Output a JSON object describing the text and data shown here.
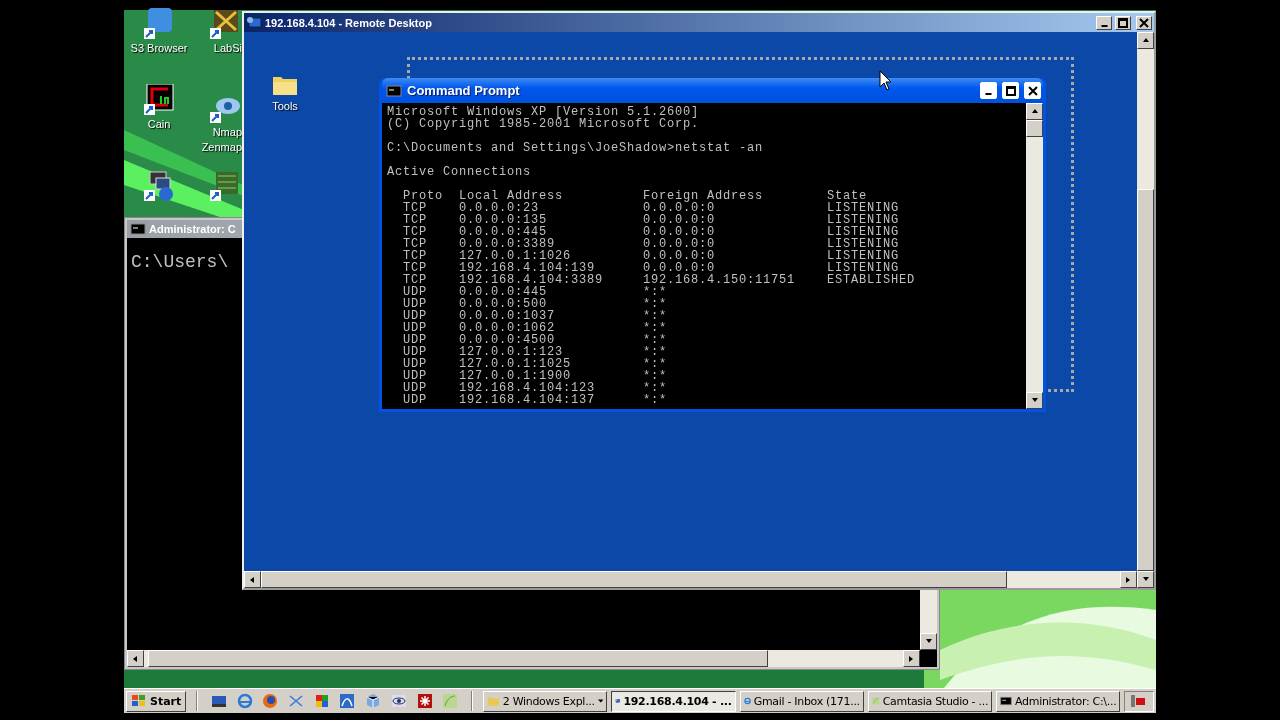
{
  "desktop": {
    "icons": [
      {
        "kind": "s3",
        "lines": [
          "S3 Browser"
        ]
      },
      {
        "kind": "labsim",
        "lines": [
          "LabSi"
        ]
      },
      {
        "kind": "cain",
        "lines": [
          "Cain"
        ]
      },
      {
        "kind": "nmap",
        "lines": [
          "Nmap",
          "Zenmap"
        ]
      },
      {
        "kind": "vpn"
      },
      {
        "kind": "cisco"
      }
    ]
  },
  "admin_console": {
    "title": "Administrator: C",
    "text": "C:\\Users\\"
  },
  "remote_desktop": {
    "title": "192.168.4.104 - Remote Desktop",
    "icons": [
      {
        "label": "Tools"
      }
    ],
    "command_prompt": {
      "title": "Command Prompt",
      "intro": [
        {
          "lines": [
            "Microsoft Windows XP [Version 5.1.2600]",
            "(C) Copyright 1985-2001 Microsoft Corp."
          ]
        },
        {
          "lines": [
            "C:\\Documents and Settings\\JoeShadow>netstat -an"
          ]
        },
        {
          "lines": [
            "Active Connections"
          ]
        }
      ],
      "columns": [
        "Proto",
        "Local Address",
        "Foreign Address",
        "State"
      ],
      "connections": [
        {
          "proto": "TCP",
          "local": "0.0.0.0:23",
          "foreign": "0.0.0.0:0",
          "state": "LISTENING"
        },
        {
          "proto": "TCP",
          "local": "0.0.0.0:135",
          "foreign": "0.0.0.0:0",
          "state": "LISTENING"
        },
        {
          "proto": "TCP",
          "local": "0.0.0.0:445",
          "foreign": "0.0.0.0:0",
          "state": "LISTENING"
        },
        {
          "proto": "TCP",
          "local": "0.0.0.0:3389",
          "foreign": "0.0.0.0:0",
          "state": "LISTENING"
        },
        {
          "proto": "TCP",
          "local": "127.0.0.1:1026",
          "foreign": "0.0.0.0:0",
          "state": "LISTENING"
        },
        {
          "proto": "TCP",
          "local": "192.168.4.104:139",
          "foreign": "0.0.0.0:0",
          "state": "LISTENING"
        },
        {
          "proto": "TCP",
          "local": "192.168.4.104:3389",
          "foreign": "192.168.4.150:11751",
          "state": "ESTABLISHED"
        },
        {
          "proto": "UDP",
          "local": "0.0.0.0:445",
          "foreign": "*:*"
        },
        {
          "proto": "UDP",
          "local": "0.0.0.0:500",
          "foreign": "*:*"
        },
        {
          "proto": "UDP",
          "local": "0.0.0.0:1037",
          "foreign": "*:*"
        },
        {
          "proto": "UDP",
          "local": "0.0.0.0:1062",
          "foreign": "*:*"
        },
        {
          "proto": "UDP",
          "local": "0.0.0.0:4500",
          "foreign": "*:*"
        },
        {
          "proto": "UDP",
          "local": "127.0.0.1:123",
          "foreign": "*:*"
        },
        {
          "proto": "UDP",
          "local": "127.0.0.1:1025",
          "foreign": "*:*"
        },
        {
          "proto": "UDP",
          "local": "127.0.0.1:1900",
          "foreign": "*:*"
        },
        {
          "proto": "UDP",
          "local": "192.168.4.104:123",
          "foreign": "*:*"
        },
        {
          "proto": "UDP",
          "local": "192.168.4.104:137",
          "foreign": "*:*"
        }
      ]
    }
  },
  "taskbar": {
    "start": "Start",
    "quick_launch": [
      {
        "kind": "monitor"
      },
      {
        "kind": "ie"
      },
      {
        "kind": "firefox"
      },
      {
        "kind": "cross"
      },
      {
        "kind": "tiles"
      },
      {
        "kind": "fin"
      },
      {
        "kind": "cube"
      },
      {
        "kind": "eye"
      },
      {
        "kind": "asterisk"
      },
      {
        "kind": "leaf"
      }
    ],
    "tasks": [
      {
        "kind": "folder",
        "label": "2 Windows Expl...",
        "grouped": true,
        "selected": false
      },
      {
        "kind": "rdp",
        "label": "192.168.4.104 - ...",
        "grouped": false,
        "selected": true
      },
      {
        "kind": "ie",
        "label": "Gmail - Inbox (171...",
        "grouped": false,
        "selected": false
      },
      {
        "kind": "leaf",
        "label": "Camtasia Studio - ...",
        "grouped": false,
        "selected": false
      },
      {
        "kind": "console",
        "label": "Administrator: C:\\...",
        "grouped": false,
        "selected": false
      }
    ]
  }
}
